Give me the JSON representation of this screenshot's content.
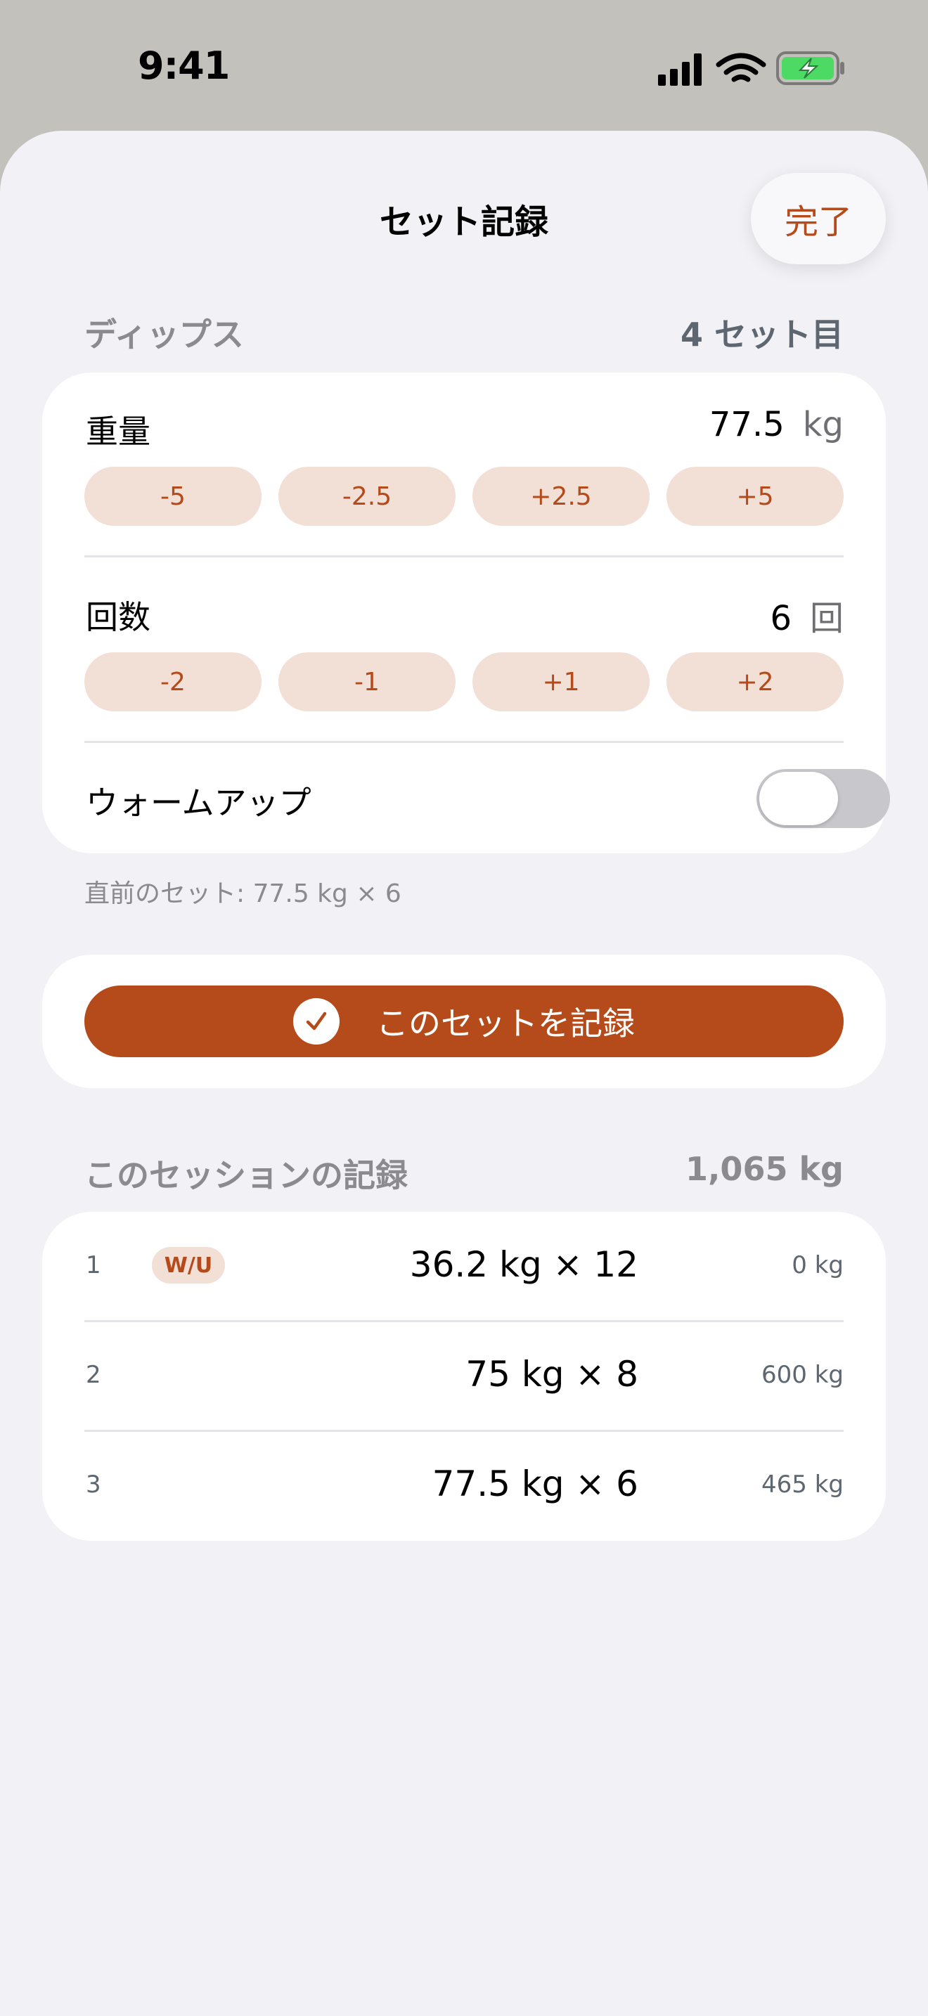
{
  "status_bar": {
    "time": "9:41"
  },
  "header": {
    "title": "セット記録",
    "done_label": "完了"
  },
  "exercise": {
    "name": "ディップス",
    "set_label": "4 セット目"
  },
  "weight": {
    "label": "重量",
    "value": "77.5",
    "unit": "kg",
    "steppers": [
      "-5",
      "-2.5",
      "+2.5",
      "+5"
    ]
  },
  "reps": {
    "label": "回数",
    "value": "6",
    "unit": "回",
    "steppers": [
      "-2",
      "-1",
      "+1",
      "+2"
    ]
  },
  "warmup": {
    "label": "ウォームアップ",
    "on": false
  },
  "previous_set": "直前のセット: 77.5 kg × 6",
  "record_button": {
    "label": "このセットを記録"
  },
  "session": {
    "title": "このセッションの記録",
    "total": "1,065 kg",
    "sets": [
      {
        "num": "1",
        "badge": "W/U",
        "set": "36.2 kg × 12",
        "volume": "0 kg"
      },
      {
        "num": "2",
        "badge": "",
        "set": "75 kg × 8",
        "volume": "600 kg"
      },
      {
        "num": "3",
        "badge": "",
        "set": "77.5 kg × 6",
        "volume": "465 kg"
      }
    ]
  },
  "colors": {
    "accent": "#b54b1a",
    "stepper_bg": "#f2dfd5",
    "battery": "#4cd964"
  }
}
